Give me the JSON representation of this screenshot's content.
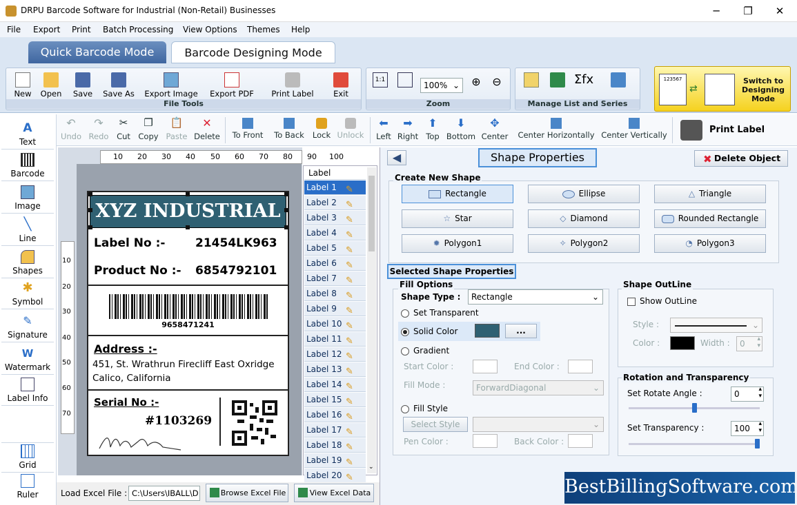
{
  "window": {
    "title": "DRPU Barcode Software for Industrial (Non-Retail) Businesses",
    "minimize": "─",
    "maximize": "❐",
    "close": "✕"
  },
  "menu": [
    "File",
    "Export",
    "Print",
    "Batch Processing",
    "View Options",
    "Themes",
    "Help"
  ],
  "mode_tabs": {
    "quick": "Quick Barcode Mode",
    "designing": "Barcode Designing Mode"
  },
  "file_tools": {
    "group_label": "File Tools",
    "new": "New",
    "open": "Open",
    "save": "Save",
    "save_as": "Save As",
    "export_image": "Export Image",
    "export_pdf": "Export PDF",
    "print_label": "Print Label",
    "exit": "Exit"
  },
  "zoom": {
    "group_label": "Zoom",
    "value": "100%"
  },
  "manage": {
    "group_label": "Manage List and Series"
  },
  "switch": {
    "label": "Switch to Designing Mode",
    "sample_number": "123567"
  },
  "toolbar": {
    "undo": "Undo",
    "redo": "Redo",
    "cut": "Cut",
    "copy": "Copy",
    "paste": "Paste",
    "delete": "Delete",
    "to_front": "To Front",
    "to_back": "To Back",
    "lock": "Lock",
    "unlock": "Unlock",
    "left": "Left",
    "right": "Right",
    "top": "Top",
    "bottom": "Bottom",
    "center": "Center",
    "center_h": "Center Horizontally",
    "center_v": "Center Vertically",
    "print_label": "Print Label"
  },
  "left_tools": [
    "Text",
    "Barcode",
    "Image",
    "Line",
    "Shapes",
    "Symbol",
    "Signature",
    "Watermark",
    "Label Info",
    "Grid",
    "Ruler"
  ],
  "ruler": {
    "h": [
      "10",
      "20",
      "30",
      "40",
      "50",
      "60",
      "70",
      "80",
      "90",
      "100"
    ],
    "v": [
      "10",
      "20",
      "30",
      "40",
      "50",
      "60",
      "70"
    ]
  },
  "label_card": {
    "header": "XYZ INDUSTRIAL",
    "label_no_key": "Label No :-",
    "label_no_val": "21454LK963",
    "product_no_key": "Product No :-",
    "product_no_val": "6854792101",
    "barcode_text": "9658471241",
    "address_key": "Address :-",
    "address_line1": "451, St. Wrathrun Firecliff East Oxridge",
    "address_line2": "Calico, California",
    "serial_key": "Serial No :-",
    "serial_val": "#1103269",
    "colors": {
      "header": "#2f6072",
      "border": "#222222"
    }
  },
  "label_list": {
    "header": "Label",
    "items": [
      "Label 1",
      "Label 2",
      "Label 3",
      "Label 4",
      "Label 5",
      "Label 6",
      "Label 7",
      "Label 8",
      "Label 9",
      "Label 10",
      "Label 11",
      "Label 12",
      "Label 13",
      "Label 14",
      "Label 15",
      "Label 16",
      "Label 17",
      "Label 18",
      "Label 19",
      "Label 20"
    ],
    "selected": 0
  },
  "bottom": {
    "load_label": "Load Excel File :",
    "path": "C:\\Users\\IBALL\\D",
    "browse": "Browse Excel File",
    "view": "View Excel Data"
  },
  "props": {
    "title": "Shape Properties",
    "delete_object": "Delete Object",
    "create_new": "Create New Shape",
    "shapes": [
      "Rectangle",
      "Ellipse",
      "Triangle",
      "Star",
      "Diamond",
      "Rounded Rectangle",
      "Polygon1",
      "Polygon2",
      "Polygon3"
    ],
    "selected_props": "Selected Shape Properties",
    "fill_options": "Fill Options",
    "shape_type_label": "Shape Type :",
    "shape_type_value": "Rectangle",
    "set_transparent": "Set Transparent",
    "solid_color": "Solid Color",
    "solid_color_hex": "#2f6072",
    "more": "...",
    "gradient": "Gradient",
    "start_color": "Start Color :",
    "end_color": "End Color :",
    "fill_mode": "Fill Mode :",
    "fill_mode_value": "ForwardDiagonal",
    "fill_style": "Fill Style",
    "select_style": "Select Style",
    "pen_color": "Pen Color :",
    "back_color": "Back Color :",
    "shape_outline": "Shape OutLine",
    "show_outline": "Show OutLine",
    "style": "Style :",
    "color": "Color :",
    "width": "Width :",
    "width_value": "0",
    "rotation": "Rotation and Transparency",
    "rotate_label": "Set Rotate Angle :",
    "rotate_value": "0",
    "transparency_label": "Set Transparency :",
    "transparency_value": "100"
  },
  "watermark_logo": "BestBillingSoftware.com"
}
